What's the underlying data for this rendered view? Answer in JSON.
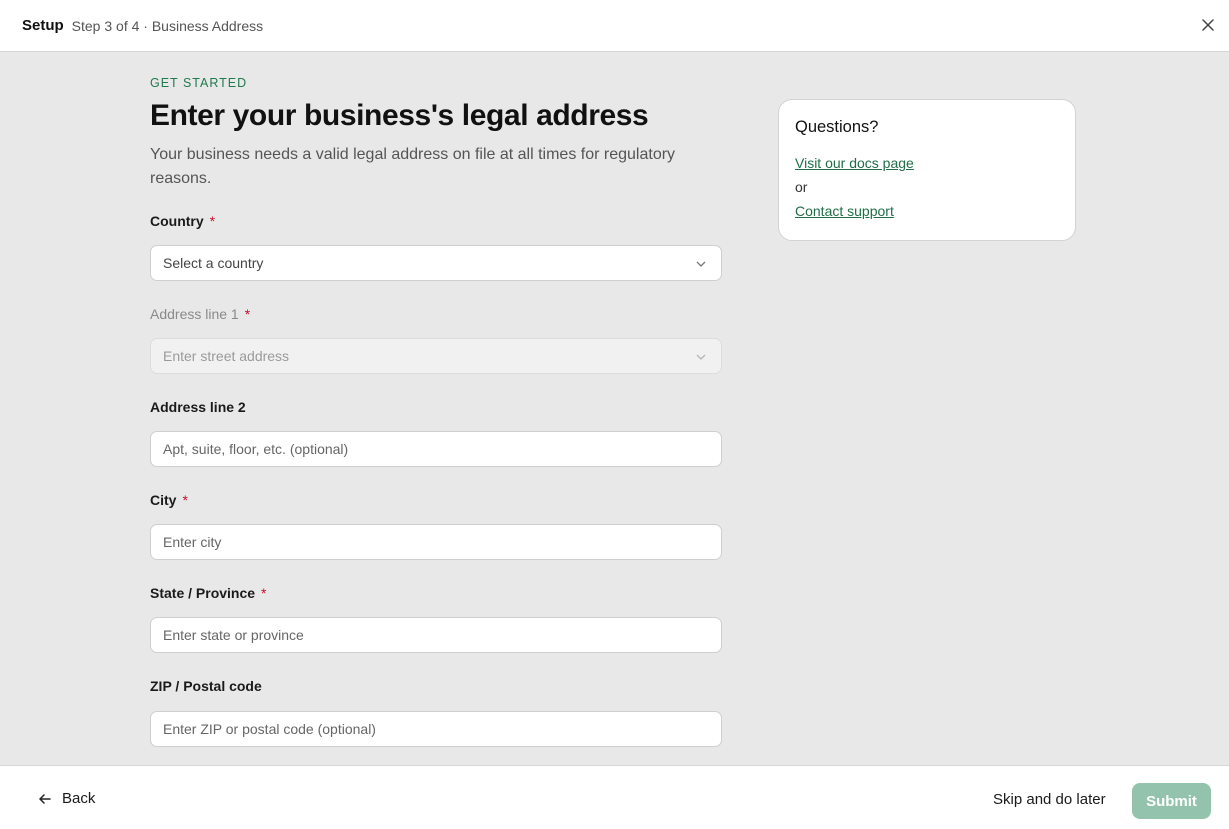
{
  "header": {
    "title": "Setup",
    "step": "Step 3 of 4 · Business Address"
  },
  "form": {
    "eyebrow": "GET STARTED",
    "heading": "Enter your business's legal address",
    "subtext": "Your business needs a valid legal address on file at all times for regulatory reasons.",
    "required_marker": "*",
    "fields": {
      "country": {
        "label": "Country",
        "placeholder": "Select a country"
      },
      "address1": {
        "label": "Address line 1",
        "placeholder": "Enter street address"
      },
      "address2": {
        "label": "Address line 2",
        "placeholder": "Apt, suite, floor, etc. (optional)"
      },
      "city": {
        "label": "City",
        "placeholder": "Enter city"
      },
      "state": {
        "label": "State / Province",
        "placeholder": "Enter state or province"
      },
      "zip": {
        "label": "ZIP / Postal code",
        "placeholder": "Enter ZIP or postal code (optional)"
      }
    }
  },
  "help": {
    "title": "Questions?",
    "docs_link": "Visit our docs page",
    "or": "or",
    "support_link": "Contact support"
  },
  "footer": {
    "back": "Back",
    "skip": "Skip and do later",
    "submit": "Submit"
  },
  "colors": {
    "accent_green": "#1f7a4d",
    "submit_disabled": "#94c3ad",
    "required_red": "#c8102e"
  }
}
